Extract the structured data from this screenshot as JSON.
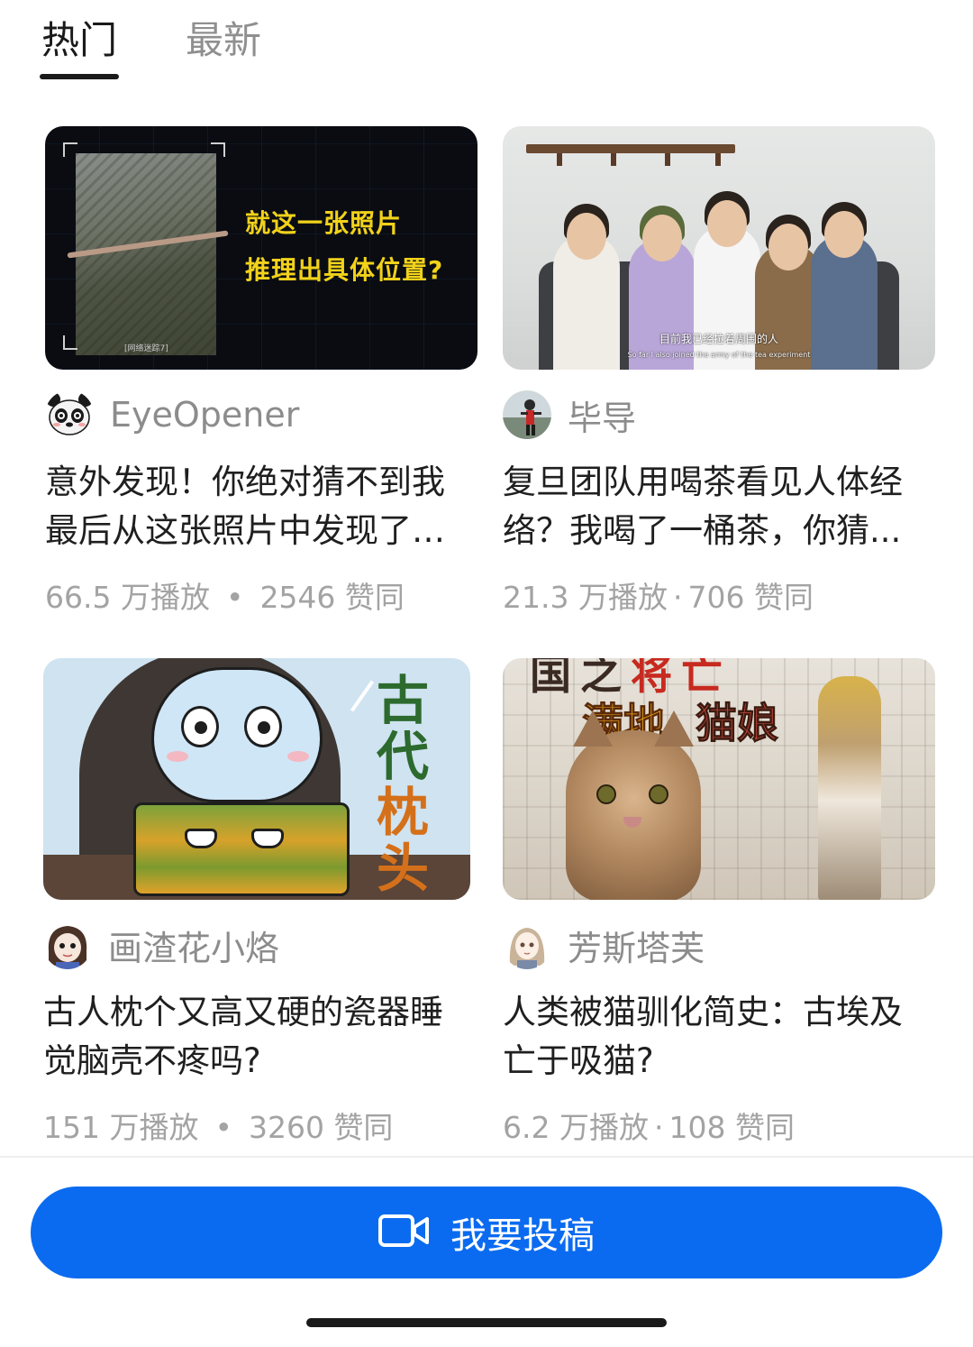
{
  "tabs": [
    {
      "label": "热门",
      "active": true
    },
    {
      "label": "最新",
      "active": false
    }
  ],
  "cards": [
    {
      "thumb_text": [
        "就这一张照片",
        "推理出具体位置?"
      ],
      "thumb_caption": "[网络迷踪7]",
      "author": "EyeOpener",
      "title": "意外发现！你绝对猜不到我最后从这张照片中发现了什么",
      "plays": "66.5 万播放",
      "sep": "•",
      "likes": "2546 赞同"
    },
    {
      "thumb_subtitle": "目前我已经拉着周围的人",
      "thumb_subtitle_en": "So far I also joined the army of the tea experiment",
      "author": "毕导",
      "title": "复旦团队用喝茶看见人体经络？我喝了一桶茶，你猜...",
      "plays": "21.3 万播放",
      "sep": "·",
      "likes": "706 赞同"
    },
    {
      "thumb_text": [
        "古",
        "代",
        "枕",
        "头"
      ],
      "author": "画渣花小烙",
      "title": "古人枕个又高又硬的瓷器睡觉脑壳不疼吗?",
      "plays": "151 万播放",
      "sep": "•",
      "likes": "3260 赞同"
    },
    {
      "thumb_top": [
        "国之",
        "将亡"
      ],
      "thumb_text": [
        "满地",
        "猫娘"
      ],
      "author": "芳斯塔芙",
      "title": "人类被猫驯化简史：古埃及亡于吸猫?",
      "plays": "6.2 万播放",
      "sep": "·",
      "likes": "108 赞同"
    }
  ],
  "submit": {
    "label": "我要投稿",
    "icon": "video-camera-icon"
  },
  "colors": {
    "accent": "#0b6bf0",
    "meta": "#a3a3a3",
    "author": "#8c8c8c"
  }
}
